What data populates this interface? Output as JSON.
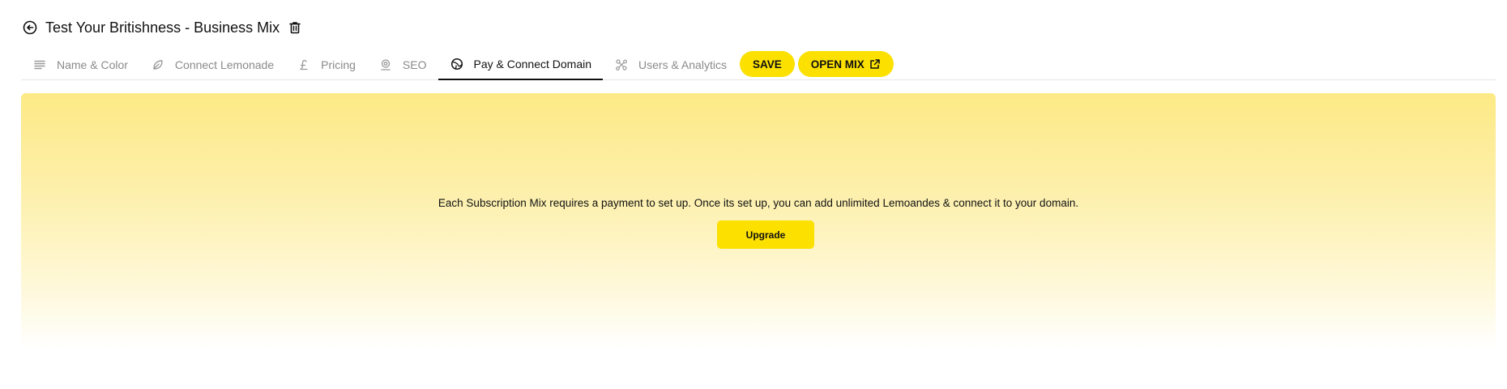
{
  "header": {
    "title": "Test Your Britishness - Business Mix",
    "back_icon": "back-arrow-circle-icon",
    "delete_icon": "trash-icon"
  },
  "tabs": [
    {
      "label": "Name & Color",
      "icon": "text-lines-icon",
      "active": false
    },
    {
      "label": "Connect Lemonade",
      "icon": "leaf-icon",
      "active": false
    },
    {
      "label": "Pricing",
      "icon": "pound-sign-icon",
      "active": false
    },
    {
      "label": "SEO",
      "icon": "map-pin-icon",
      "active": false
    },
    {
      "label": "Pay & Connect Domain",
      "icon": "globe-icon",
      "active": true
    },
    {
      "label": "Users & Analytics",
      "icon": "network-icon",
      "active": false
    }
  ],
  "actions": {
    "save_label": "SAVE",
    "open_mix_label": "OPEN MIX"
  },
  "panel": {
    "message": "Each Subscription Mix requires a payment to set up. Once its set up, you can add unlimited Lemoandes & connect it to your domain.",
    "upgrade_label": "Upgrade"
  },
  "colors": {
    "accent": "#fbe000",
    "panel_top": "#fde985",
    "inactive_text": "#8a8a8a"
  }
}
